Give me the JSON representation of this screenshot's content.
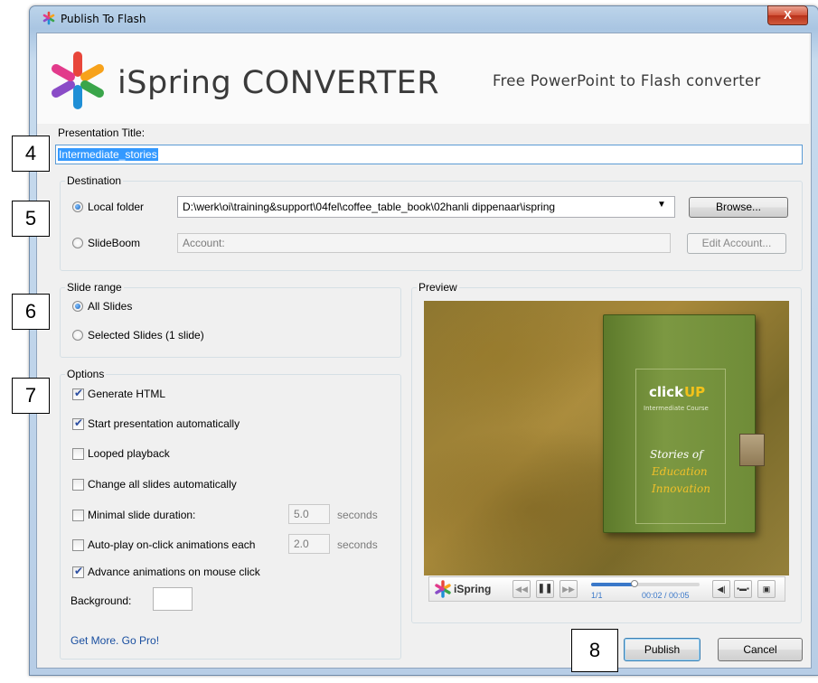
{
  "window": {
    "title": "Publish To Flash",
    "close_label": "X"
  },
  "header": {
    "product_name": "iSpring CONVERTER",
    "tagline": "Free PowerPoint to Flash converter"
  },
  "presentation": {
    "label": "Presentation Title:",
    "value": "Intermediate_stories"
  },
  "destination": {
    "group_label": "Destination",
    "local_folder_label": "Local folder",
    "local_folder_path": "D:\\werk\\oi\\training&support\\04fel\\coffee_table_book\\02hanli dippenaar\\ispring",
    "browse_label": "Browse...",
    "slideboom_label": "SlideBoom",
    "account_placeholder": "Account:",
    "edit_account_label": "Edit Account..."
  },
  "slide_range": {
    "group_label": "Slide range",
    "all_label": "All Slides",
    "selected_label": "Selected Slides (1 slide)"
  },
  "options": {
    "group_label": "Options",
    "generate_html": "Generate HTML",
    "start_auto": "Start presentation automatically",
    "looped": "Looped playback",
    "change_all": "Change all slides automatically",
    "min_duration": "Minimal slide duration:",
    "min_duration_value": "5.0",
    "min_duration_unit": "seconds",
    "autoplay": "Auto-play on-click animations each",
    "autoplay_value": "2.0",
    "autoplay_unit": "seconds",
    "advance": "Advance animations on mouse click",
    "background": "Background:"
  },
  "preview": {
    "group_label": "Preview",
    "book": {
      "title_part1": "click",
      "title_part2": "UP",
      "subtitle": "Intermediate Course",
      "line1": "Stories of",
      "line2": "Education",
      "line3": "Innovation"
    },
    "player": {
      "brand": "iSpring",
      "slide_counter": "1/1",
      "time": "00:02 / 00:05",
      "progress": 0.4
    }
  },
  "footer": {
    "pro_link": "Get More. Go Pro!",
    "publish_label": "Publish",
    "cancel_label": "Cancel"
  },
  "callouts": [
    "4",
    "5",
    "6",
    "7",
    "8"
  ]
}
